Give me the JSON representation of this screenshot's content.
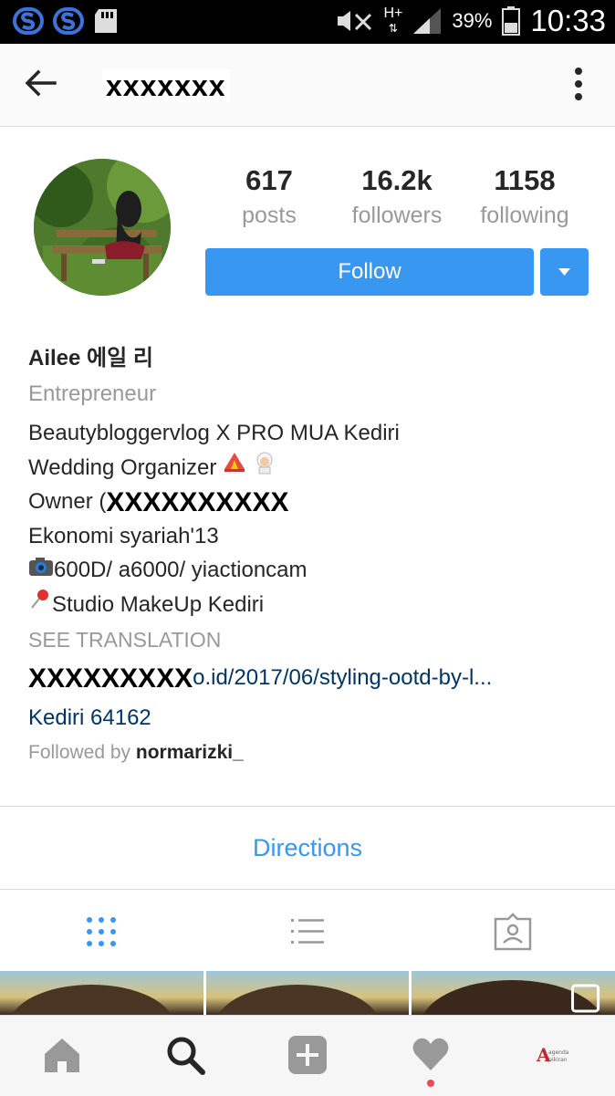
{
  "status_bar": {
    "battery": "39%",
    "time": "10:33",
    "network": "H+",
    "icons": [
      "samsung-s-icon",
      "samsung-s-icon",
      "sd-card-icon",
      "mute-icon",
      "network-icon",
      "signal-icon",
      "battery-icon"
    ]
  },
  "header": {
    "username": "xxxxxxx",
    "icons": [
      "back-arrow-icon",
      "more-vert-icon"
    ]
  },
  "profile": {
    "stats": [
      {
        "value": "617",
        "label": "posts"
      },
      {
        "value": "16.2k",
        "label": "followers"
      },
      {
        "value": "1158",
        "label": "following"
      }
    ],
    "follow_label": "Follow",
    "name": "Ailee 에일 리",
    "category": "Entrepreneur",
    "bio": {
      "line1": "Beautybloggervlog X PRO MUA Kediri",
      "line2": "Wedding Organizer",
      "line3_prefix": "Owner (",
      "line3_redacted": "XXXXXXXXXX",
      "line4": "Ekonomi syariah'13",
      "line5": "600D/ a6000/ yiactioncam",
      "line6": "Studio MakeUp Kediri"
    },
    "see_translation": "SEE TRANSLATION",
    "link_redacted": "XXXXXXXXX",
    "link_text": "o.id/2017/06/styling-ootd-by-l...",
    "location": "Kediri 64162",
    "followed_by_prefix": "Followed by",
    "followed_by_user": "normarizki_"
  },
  "directions_label": "Directions",
  "view_tabs": [
    "grid-view-icon",
    "list-view-icon",
    "tagged-photos-icon"
  ],
  "bottom_nav": [
    "home-icon",
    "search-icon",
    "add-post-icon",
    "activity-heart-icon",
    "profile-icon"
  ],
  "colors": {
    "accent": "#3897f0",
    "link": "#003569",
    "muted": "#999999",
    "activity_dot": "#ed4956"
  }
}
